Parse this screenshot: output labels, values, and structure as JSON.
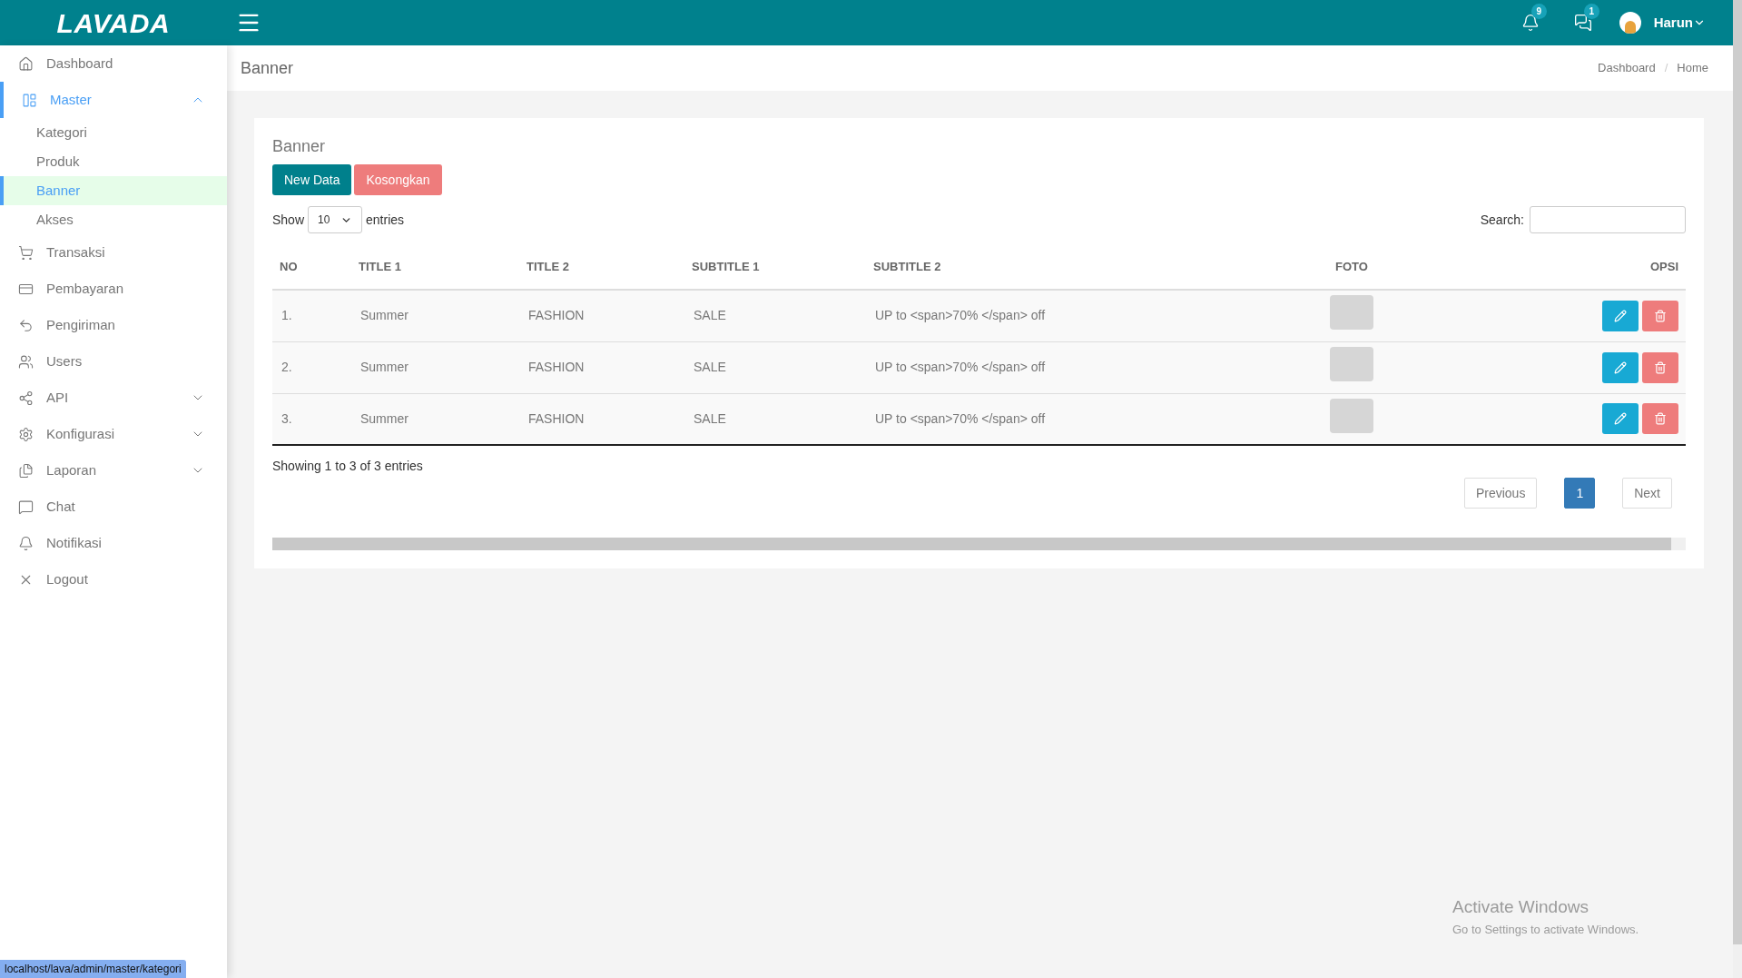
{
  "topbar": {
    "logo": "LAVADA",
    "notifications": {
      "count": "9"
    },
    "messages": {
      "count": "1"
    },
    "user": {
      "name": "Harun"
    }
  },
  "sidebar": {
    "items": [
      {
        "label": "Dashboard",
        "selected": false
      },
      {
        "label": "Master",
        "selected": true,
        "expanded": true,
        "children": [
          {
            "label": "Kategori",
            "selected": false
          },
          {
            "label": "Produk",
            "selected": false
          },
          {
            "label": "Banner",
            "selected": true
          },
          {
            "label": "Akses",
            "selected": false
          }
        ]
      },
      {
        "label": "Transaksi",
        "selected": false
      },
      {
        "label": "Pembayaran",
        "selected": false
      },
      {
        "label": "Pengiriman",
        "selected": false
      },
      {
        "label": "Users",
        "selected": false
      },
      {
        "label": "API",
        "selected": false,
        "expanded": false
      },
      {
        "label": "Konfigurasi",
        "selected": false,
        "expanded": false
      },
      {
        "label": "Laporan",
        "selected": false,
        "expanded": false
      },
      {
        "label": "Chat",
        "selected": false
      },
      {
        "label": "Notifikasi",
        "selected": false
      },
      {
        "label": "Logout",
        "selected": false
      }
    ]
  },
  "page_header": {
    "title": "Banner",
    "breadcrumb": [
      "Dashboard",
      "Home"
    ],
    "breadcrumb_separator": "/"
  },
  "card": {
    "title": "Banner",
    "buttons": [
      {
        "label": "New Data",
        "kind": "primary"
      },
      {
        "label": "Kosongkan",
        "kind": "danger"
      }
    ],
    "show": {
      "before": "Show",
      "value": "10",
      "after": "entries"
    },
    "search": {
      "label": "Search:"
    },
    "table": {
      "columns": [
        "NO",
        "TITLE 1",
        "TITLE 2",
        "SUBTITLE 1",
        "SUBTITLE 2",
        "FOTO",
        "OPSI"
      ],
      "rows": [
        {
          "no": "1.",
          "title_1": "Summer",
          "title_2": "FASHION",
          "subtitle_1": "SALE",
          "subtitle_2": "UP to <span>70% </span> off"
        },
        {
          "no": "2.",
          "title_1": "Summer",
          "title_2": "FASHION",
          "subtitle_1": "SALE",
          "subtitle_2": "UP to <span>70% </span> off"
        },
        {
          "no": "3.",
          "title_1": "Summer",
          "title_2": "FASHION",
          "subtitle_1": "SALE",
          "subtitle_2": "UP to <span>70% </span> off"
        }
      ]
    },
    "info": "Showing 1 to 3 of 3 entries",
    "pagination": [
      {
        "label": "Previous",
        "selected": false
      },
      {
        "label": "1",
        "selected": true
      },
      {
        "label": "Next",
        "selected": false
      }
    ]
  },
  "status_url": "localhost/lava/admin/master/kategori",
  "watermark_os": {
    "title": "Activate Windows",
    "subtitle": "Go to Settings to activate Windows."
  }
}
